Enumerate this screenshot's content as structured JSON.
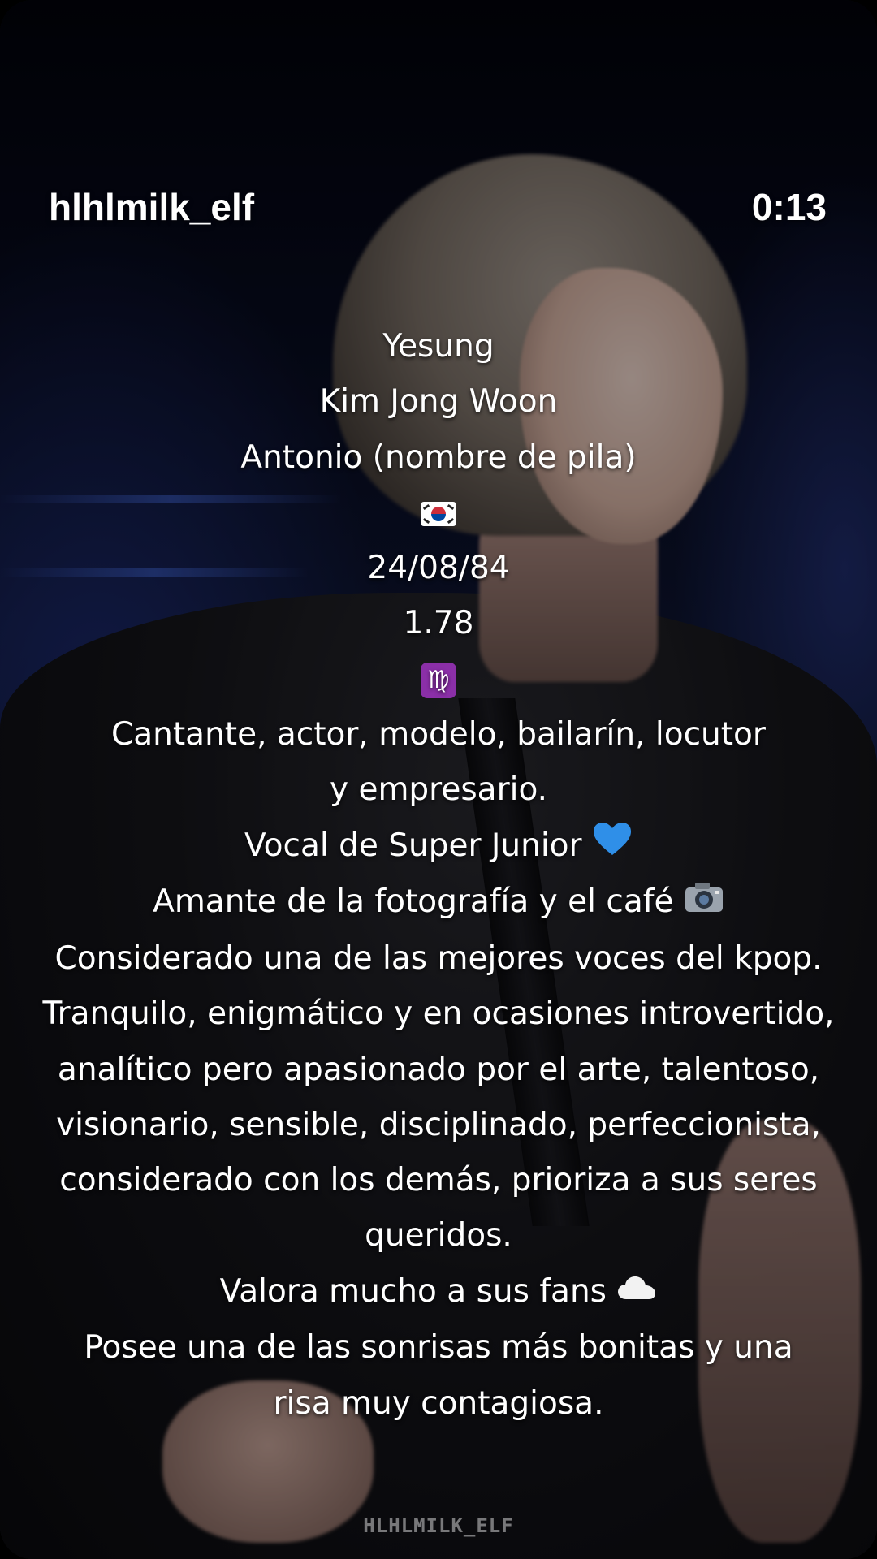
{
  "header": {
    "username": "hlhlmilk_elf",
    "timer": "0:13"
  },
  "caption": {
    "name": "Yesung",
    "real_name": "Kim Jong Woon",
    "baptismal_name": "Antonio (nombre de pila)",
    "flag_icon": "south-korea-flag-icon",
    "birthdate": "24/08/84",
    "height": "1.78",
    "zodiac_icon": "virgo-icon",
    "occupation": "Cantante, actor, modelo, bailarín, locutor y empresario.",
    "role": "Vocal de Super Junior",
    "role_icon": "blue-heart-icon",
    "hobbies": "Amante de la fotografía y el café",
    "hobbies_icon": "camera-icon",
    "voice": "Considerado una de las mejores voces del kpop.",
    "personality": "Tranquilo, enigmático y en ocasiones introvertido, analítico pero apasionado por el arte, talentoso, visionario, sensible, disciplinado, perfeccionista, considerado con los demás, prioriza a sus seres queridos.",
    "fans": "Valora mucho a sus fans",
    "fans_icon": "cloud-icon",
    "smile": "Posee una de las sonrisas más bonitas y una risa muy contagiosa."
  },
  "watermark": "HLHLMILK_ELF",
  "colors": {
    "text": "#ffffff",
    "heart": "#2f8fe8",
    "virgo_bg": "#8b2fa8"
  }
}
